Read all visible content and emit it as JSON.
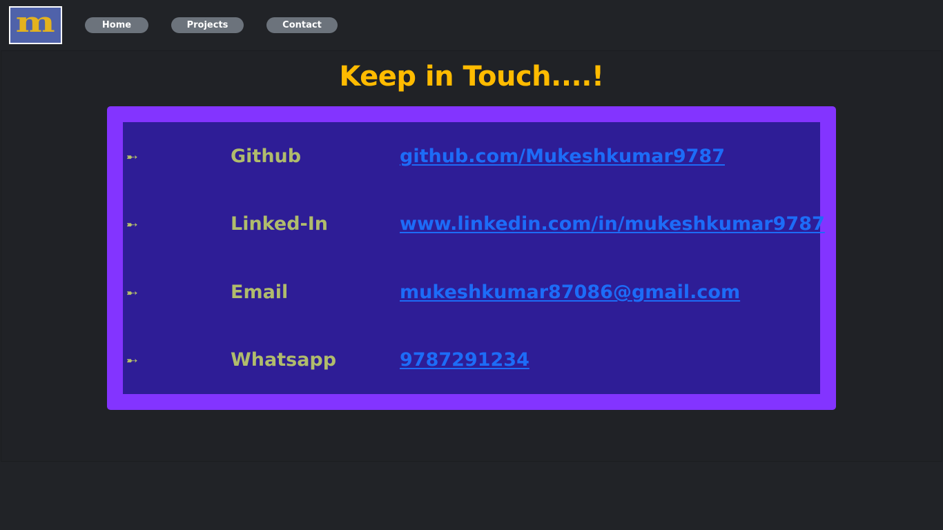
{
  "header": {
    "logo_letter": "m",
    "nav": [
      {
        "label": "Home"
      },
      {
        "label": "Projects"
      },
      {
        "label": "Contact"
      }
    ]
  },
  "main": {
    "title": "Keep in Touch....!",
    "contacts": [
      {
        "bullet": "➸",
        "label": "Github",
        "value": "github.com/Mukeshkumar9787"
      },
      {
        "bullet": "➸",
        "label": "Linked-In",
        "value": "www.linkedin.com/in/mukeshkumar9787"
      },
      {
        "bullet": "➸",
        "label": "Email",
        "value": "mukeshkumar87086@gmail.com"
      },
      {
        "bullet": "➸",
        "label": "Whatsapp",
        "value": "9787291234"
      }
    ]
  },
  "colors": {
    "background": "#212327",
    "title": "#ffbb00",
    "card_border": "#8334ff",
    "card_fill": "#2e1d96",
    "label": "#b0bc6c",
    "link": "#1d6cf7",
    "nav_button": "#6c737c",
    "logo_bg": "#4f62aa",
    "logo_letter": "#e3b21f"
  }
}
